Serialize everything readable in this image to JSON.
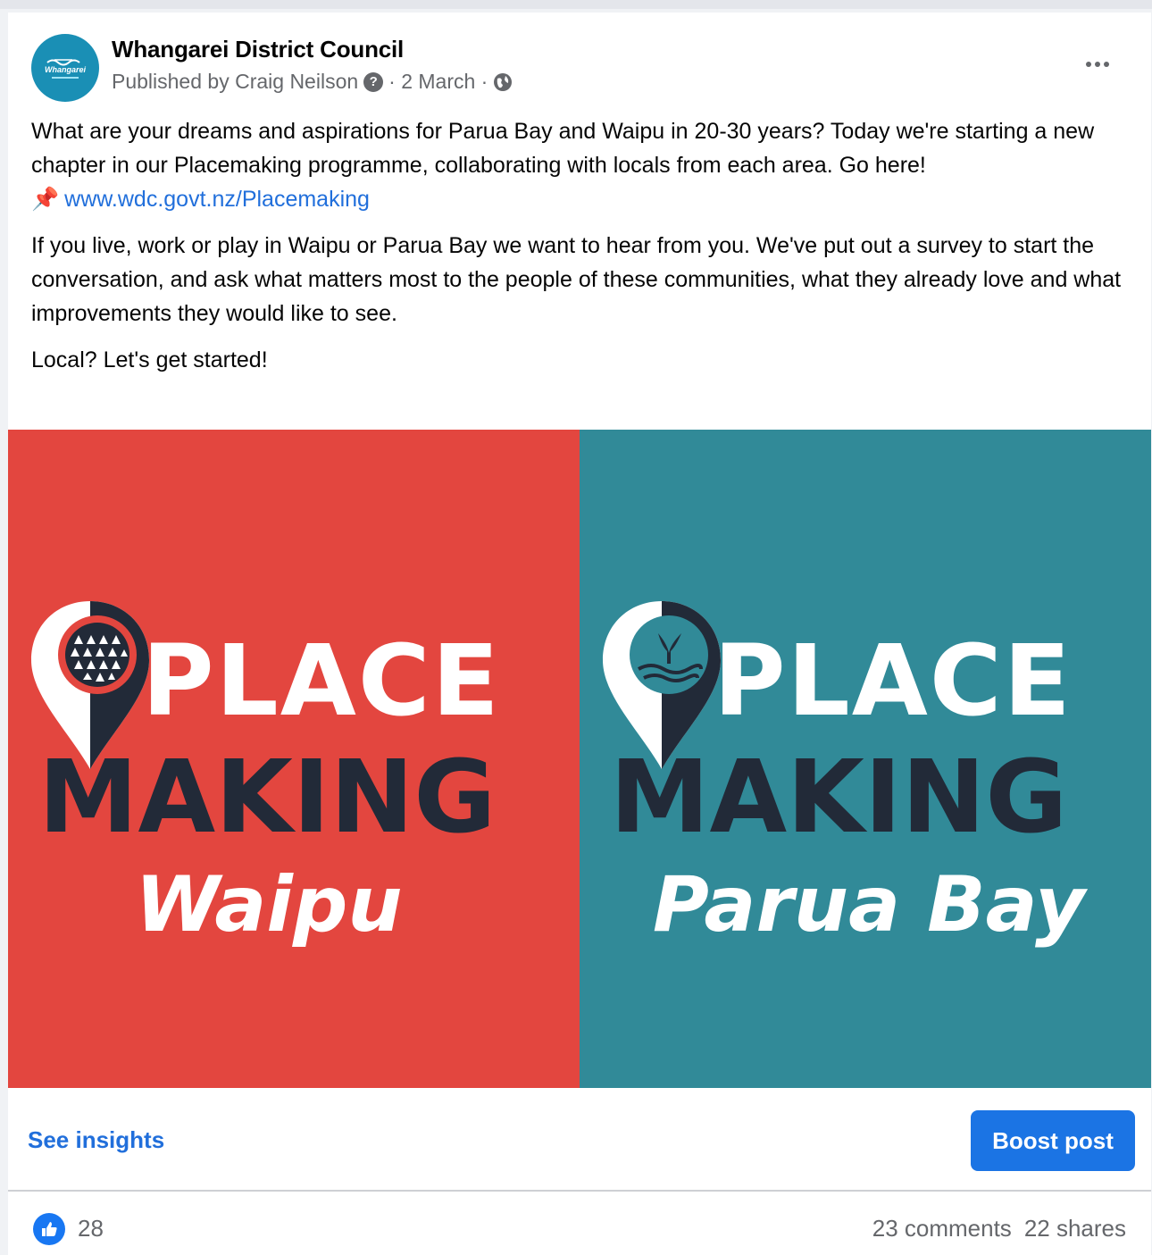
{
  "post": {
    "page_name": "Whangarei District Council",
    "avatar_text": "Whangarei",
    "published_by": "Published by Craig Neilson",
    "help_glyph": "?",
    "date": "· 2 March ·",
    "paragraph1": "What are your dreams and aspirations for Parua Bay and Waipu in 20-30 years? Today we're starting a new chapter in our Placemaking programme, collaborating with locals from each area. Go here!",
    "link_emoji": "📌",
    "link_text": "www.wdc.govt.nz/Placemaking",
    "paragraph2": "If you live, work or play in Waipu or Parua Bay we want to hear from you. We've put out a survey to start the conversation, and ask what matters most to the people of these communities, what they already love and what improvements they would like to see.",
    "paragraph3": "Local? Let's get started!"
  },
  "image": {
    "left": {
      "word1": "PLACE",
      "word2": "MAKING",
      "place": "Waipu",
      "bg_color": "#e3463f"
    },
    "right": {
      "word1": "PLACE",
      "word2": "MAKING",
      "place": "Parua Bay",
      "bg_color": "#318a98"
    }
  },
  "actions": {
    "insights_label": "See insights",
    "boost_label": "Boost post"
  },
  "reactions": {
    "like_count": "28",
    "comments": "23 comments",
    "shares": "22 shares"
  },
  "colors": {
    "link": "#216fdb",
    "boost_button": "#1b74e4",
    "like_icon": "#1877f2",
    "secondary_text": "#65676b"
  }
}
